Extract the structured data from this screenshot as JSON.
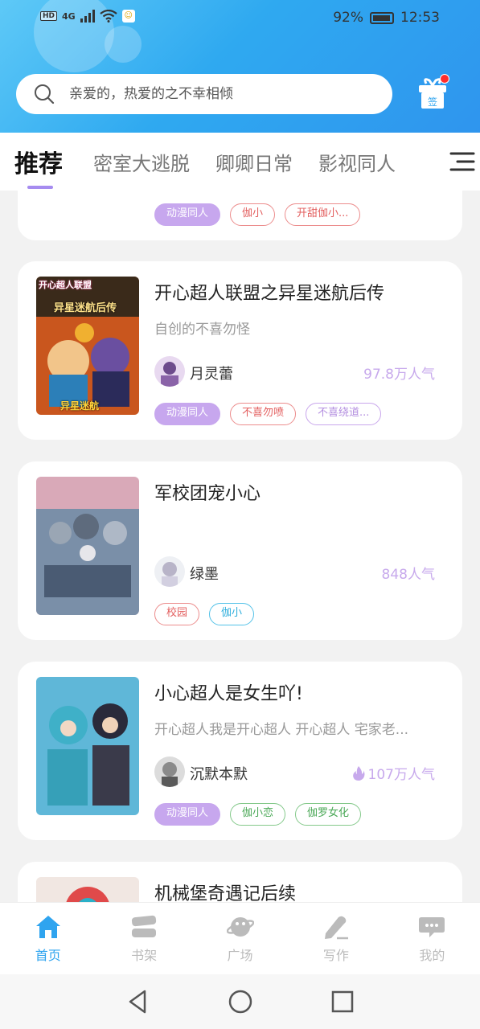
{
  "status": {
    "network": "4G",
    "hd": "HD",
    "battery": "92%",
    "time": "12:53"
  },
  "search": {
    "placeholder": "亲爱的，热爱的之不幸相倾"
  },
  "gift": {
    "label": "签"
  },
  "tabs": [
    {
      "label": "推荐"
    },
    {
      "label": "密室大逃脱"
    },
    {
      "label": "卿卿日常"
    },
    {
      "label": "影视同人"
    }
  ],
  "feed": {
    "partial_card": {
      "tags": [
        "动漫同人",
        "伽小",
        "开甜伽小..."
      ]
    },
    "cards": [
      {
        "title": "开心超人联盟之异星迷航后传",
        "desc": "自创的不喜勿怪",
        "author": "月灵蕾",
        "popularity": "97.8万人气",
        "tags": [
          "动漫同人",
          "不喜勿喷",
          "不喜绕道..."
        ],
        "cover_text": [
          "开心超人联盟",
          "异星迷航后传",
          "异星迷航"
        ]
      },
      {
        "title": "军校团宠小心",
        "desc": "",
        "author": "绿墨",
        "popularity": "848人气",
        "tags": [
          "校园",
          "伽小"
        ]
      },
      {
        "title": "小心超人是女生吖!",
        "desc": "开心超人我是开心超人 开心超人 宅家老...",
        "author": "沉默本默",
        "popularity": "107万人气",
        "tags": [
          "动漫同人",
          "伽小恋",
          "伽罗女化"
        ]
      },
      {
        "title": "机械堡奇遇记后续"
      }
    ]
  },
  "bottom_nav": [
    {
      "label": "首页",
      "icon": "home-icon"
    },
    {
      "label": "书架",
      "icon": "bookshelf-icon"
    },
    {
      "label": "广场",
      "icon": "planet-icon"
    },
    {
      "label": "写作",
      "icon": "pen-icon"
    },
    {
      "label": "我的",
      "icon": "chat-bubble-icon"
    }
  ],
  "colors": {
    "accent": "#2fa4ef",
    "tag_purple": "#c7a7ee",
    "popularity": "#c7a9ec"
  }
}
